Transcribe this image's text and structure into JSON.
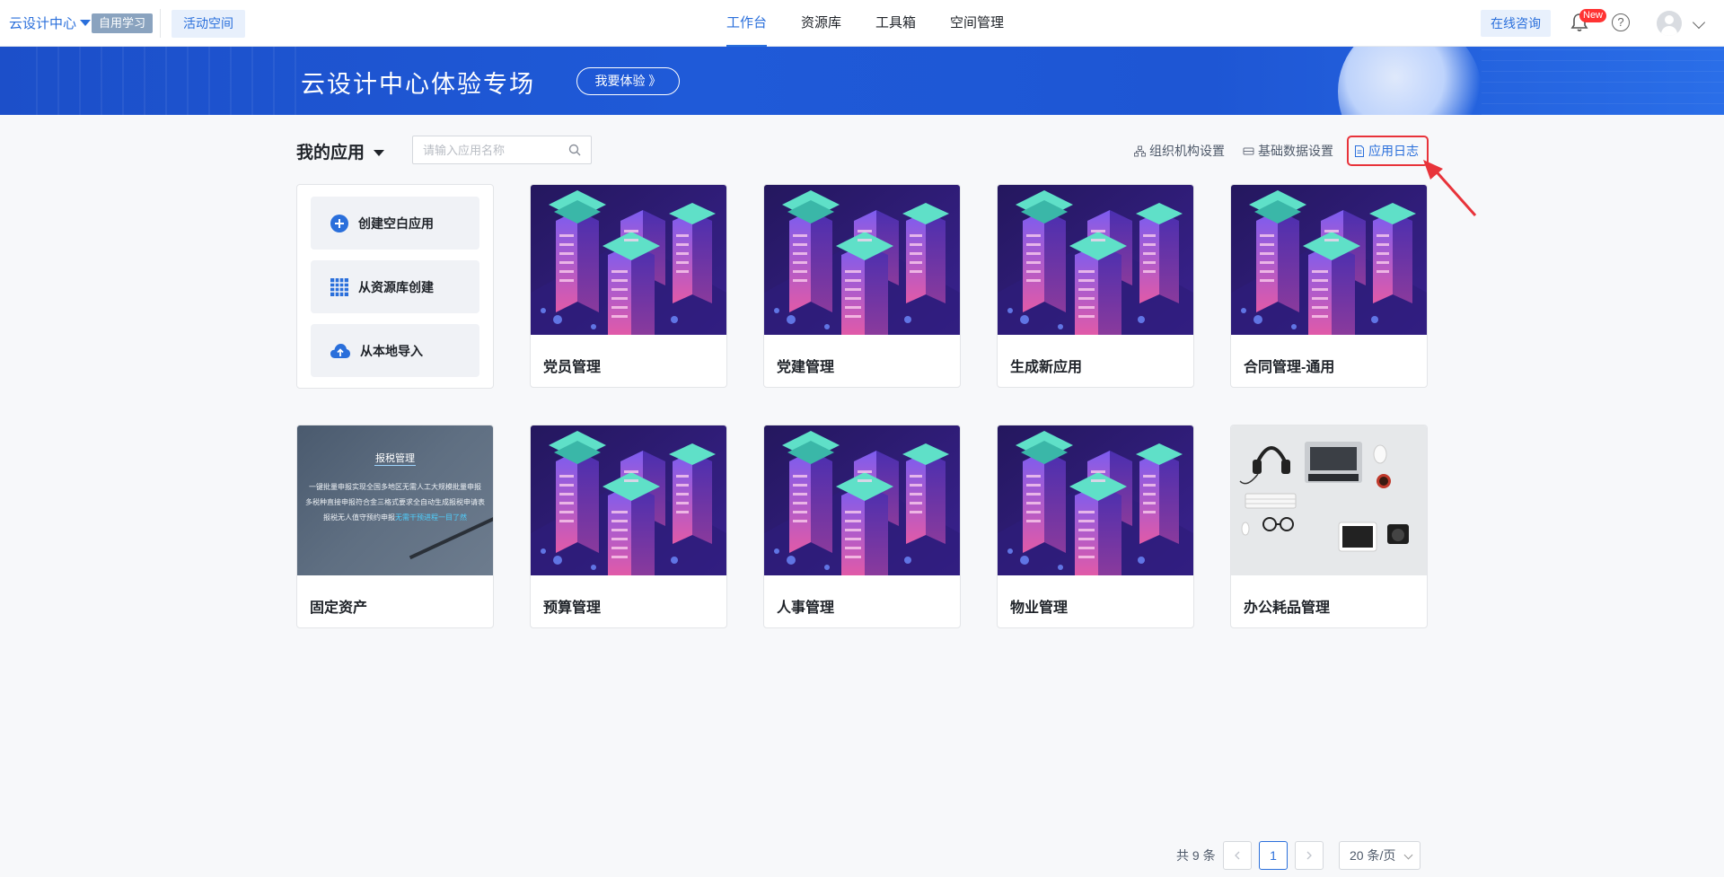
{
  "header": {
    "brand": "云设计中心",
    "self_tag": "自用学习",
    "active_space": "活动空间",
    "tabs": [
      {
        "label": "工作台",
        "active": true
      },
      {
        "label": "资源库",
        "active": false
      },
      {
        "label": "工具箱",
        "active": false
      },
      {
        "label": "空间管理",
        "active": false
      }
    ],
    "consult": "在线咨询",
    "new_badge": "New",
    "help": "?"
  },
  "banner": {
    "title": "云设计中心体验专场",
    "button": "我要体验 》"
  },
  "toolbar": {
    "title": "我的应用",
    "search_placeholder": "请输入应用名称",
    "links": {
      "org": "组织机构设置",
      "basic_data": "基础数据设置",
      "app_log": "应用日志"
    }
  },
  "create": {
    "blank": "创建空白应用",
    "from_library": "从资源库创建",
    "import_local": "从本地导入"
  },
  "apps": [
    {
      "name": "党员管理",
      "thumb": "city"
    },
    {
      "name": "党建管理",
      "thumb": "city"
    },
    {
      "name": "生成新应用",
      "thumb": "city"
    },
    {
      "name": "合同管理-通用",
      "thumb": "city"
    },
    {
      "name": "固定资产",
      "thumb": "tax"
    },
    {
      "name": "预算管理",
      "thumb": "city"
    },
    {
      "name": "人事管理",
      "thumb": "city"
    },
    {
      "name": "物业管理",
      "thumb": "city"
    },
    {
      "name": "办公耗品管理",
      "thumb": "desk"
    }
  ],
  "tax_thumb": {
    "title": "报税管理",
    "line1": "一键批量申报实现全国多地区无需人工大规模批量申报",
    "line2": "多税种直接申报符合金三格式要求全自动生成报税申请表",
    "line3_a": "报税无人值守预约申报",
    "line3_b": "无需干预进程一目了然"
  },
  "pagination": {
    "total": "共 9 条",
    "current": "1",
    "page_size": "20 条/页"
  },
  "colors": {
    "primary": "#2a6fdb",
    "highlight_box": "#e8333a",
    "banner": "#1f5ad8"
  }
}
